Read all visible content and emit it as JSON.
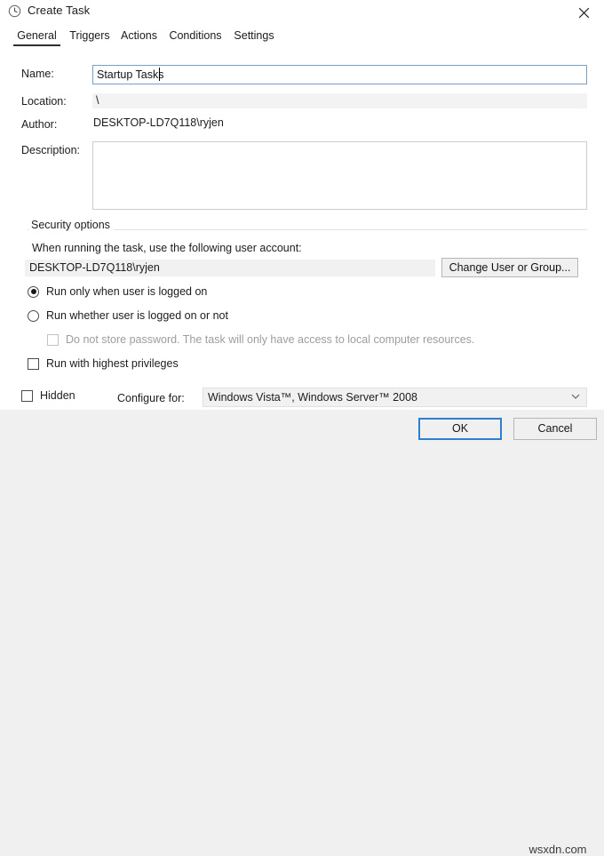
{
  "window": {
    "title": "Create Task",
    "icon": "clock-icon",
    "close_label": "✕"
  },
  "tabs": [
    {
      "label": "General",
      "active": true
    },
    {
      "label": "Triggers",
      "active": false
    },
    {
      "label": "Actions",
      "active": false
    },
    {
      "label": "Conditions",
      "active": false
    },
    {
      "label": "Settings",
      "active": false
    }
  ],
  "general": {
    "name_label": "Name:",
    "name_value": "Startup Tasks",
    "location_label": "Location:",
    "location_value": "\\",
    "author_label": "Author:",
    "author_value": "DESKTOP-LD7Q118\\ryjen",
    "description_label": "Description:",
    "description_value": ""
  },
  "security": {
    "group_title": "Security options",
    "running_label": "When running the task, use the following user account:",
    "account_value": "DESKTOP-LD7Q118\\ryjen",
    "change_user_label": "Change User or Group...",
    "options": [
      {
        "label": "Run only when user is logged on",
        "checked": true,
        "type": "radio"
      },
      {
        "label": "Run whether user is logged on or not",
        "checked": false,
        "type": "radio"
      }
    ],
    "do_not_store_password": {
      "label": "Do not store password.  The task will only have access to local computer resources.",
      "checked": false,
      "disabled": true
    },
    "run_highest_privileges": {
      "label": "Run with highest privileges",
      "checked": false
    }
  },
  "bottom": {
    "hidden_label": "Hidden",
    "hidden_checked": false,
    "configure_label": "Configure for:",
    "configure_value": "Windows Vista™, Windows Server™ 2008",
    "chevron": "chevron-down-icon"
  },
  "footer": {
    "ok_label": "OK",
    "cancel_label": "Cancel",
    "watermark": "wsxdn.com"
  },
  "colors": {
    "accent": "#2f7fd1",
    "panel": "#ffffff",
    "chrome": "#f0f0f0",
    "field_readonly": "#f1f1f1"
  }
}
